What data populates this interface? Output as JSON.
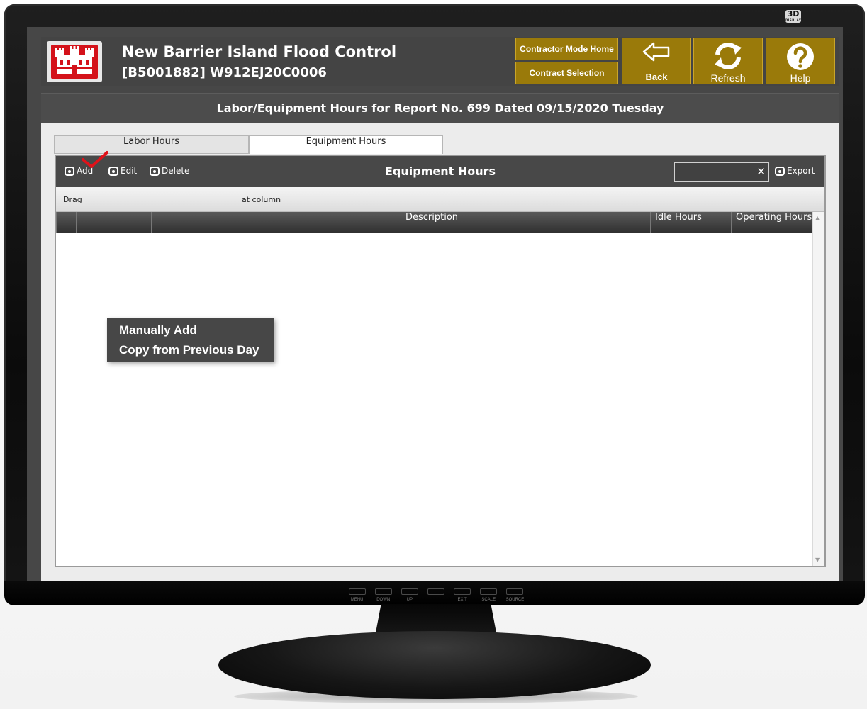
{
  "monitor": {
    "badge": "3D",
    "badge_sub": "DISPLAY",
    "buttons": [
      "MENU",
      "DOWN",
      "UP",
      "",
      "EXIT",
      "SCALE",
      "SOURCE"
    ]
  },
  "app": {
    "title": "New Barrier Island Flood Control",
    "subtitle": "[B5001882] W912EJ20C0006",
    "logo_icon": "castle-icon",
    "nav": {
      "contractor_home": "Contractor Mode Home",
      "contract_selection": "Contract Selection",
      "back": "Back",
      "refresh": "Refresh",
      "help": "Help"
    },
    "page_heading": "Labor/Equipment Hours for Report No. 699 Dated 09/15/2020 Tuesday"
  },
  "tabs": [
    {
      "label": "Labor Hours",
      "active": false
    },
    {
      "label": "Equipment Hours",
      "active": true
    }
  ],
  "grid": {
    "title": "Equipment Hours",
    "toolbar": {
      "add": "Add",
      "edit": "Edit",
      "delete": "Delete",
      "export": "Export"
    },
    "search": {
      "value": "",
      "clear": "✕"
    },
    "group_hint_left": "Drag",
    "group_hint_right": "at column",
    "columns": [
      "",
      "",
      "",
      "Description",
      "Idle Hours",
      "Operating Hours"
    ]
  },
  "add_menu": {
    "items": [
      "Manually Add",
      "Copy from Previous Day"
    ]
  },
  "colors": {
    "gold": "#9a7a0a",
    "logo_red": "#d4121a",
    "toolbar": "#484848",
    "check_red": "#e0121a"
  }
}
